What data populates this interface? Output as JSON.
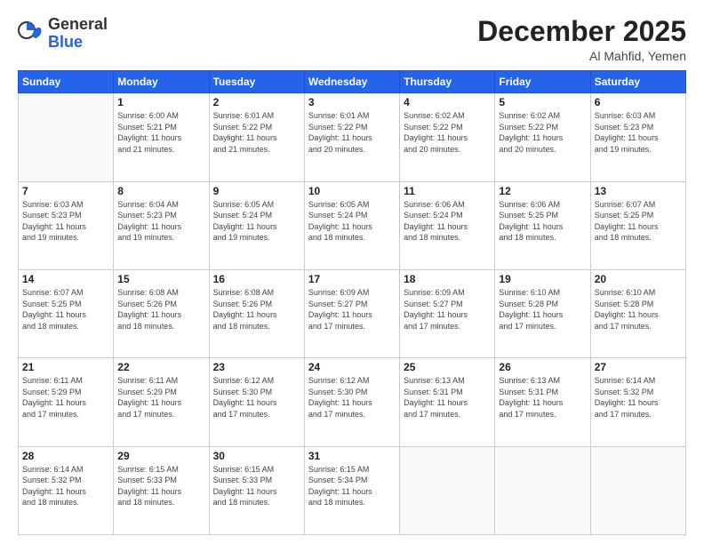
{
  "logo": {
    "general": "General",
    "blue": "Blue"
  },
  "header": {
    "month": "December 2025",
    "location": "Al Mahfid, Yemen"
  },
  "weekdays": [
    "Sunday",
    "Monday",
    "Tuesday",
    "Wednesday",
    "Thursday",
    "Friday",
    "Saturday"
  ],
  "weeks": [
    [
      {
        "day": "",
        "info": ""
      },
      {
        "day": "1",
        "info": "Sunrise: 6:00 AM\nSunset: 5:21 PM\nDaylight: 11 hours\nand 21 minutes."
      },
      {
        "day": "2",
        "info": "Sunrise: 6:01 AM\nSunset: 5:22 PM\nDaylight: 11 hours\nand 21 minutes."
      },
      {
        "day": "3",
        "info": "Sunrise: 6:01 AM\nSunset: 5:22 PM\nDaylight: 11 hours\nand 20 minutes."
      },
      {
        "day": "4",
        "info": "Sunrise: 6:02 AM\nSunset: 5:22 PM\nDaylight: 11 hours\nand 20 minutes."
      },
      {
        "day": "5",
        "info": "Sunrise: 6:02 AM\nSunset: 5:22 PM\nDaylight: 11 hours\nand 20 minutes."
      },
      {
        "day": "6",
        "info": "Sunrise: 6:03 AM\nSunset: 5:23 PM\nDaylight: 11 hours\nand 19 minutes."
      }
    ],
    [
      {
        "day": "7",
        "info": "Sunrise: 6:03 AM\nSunset: 5:23 PM\nDaylight: 11 hours\nand 19 minutes."
      },
      {
        "day": "8",
        "info": "Sunrise: 6:04 AM\nSunset: 5:23 PM\nDaylight: 11 hours\nand 19 minutes."
      },
      {
        "day": "9",
        "info": "Sunrise: 6:05 AM\nSunset: 5:24 PM\nDaylight: 11 hours\nand 19 minutes."
      },
      {
        "day": "10",
        "info": "Sunrise: 6:05 AM\nSunset: 5:24 PM\nDaylight: 11 hours\nand 18 minutes."
      },
      {
        "day": "11",
        "info": "Sunrise: 6:06 AM\nSunset: 5:24 PM\nDaylight: 11 hours\nand 18 minutes."
      },
      {
        "day": "12",
        "info": "Sunrise: 6:06 AM\nSunset: 5:25 PM\nDaylight: 11 hours\nand 18 minutes."
      },
      {
        "day": "13",
        "info": "Sunrise: 6:07 AM\nSunset: 5:25 PM\nDaylight: 11 hours\nand 18 minutes."
      }
    ],
    [
      {
        "day": "14",
        "info": "Sunrise: 6:07 AM\nSunset: 5:25 PM\nDaylight: 11 hours\nand 18 minutes."
      },
      {
        "day": "15",
        "info": "Sunrise: 6:08 AM\nSunset: 5:26 PM\nDaylight: 11 hours\nand 18 minutes."
      },
      {
        "day": "16",
        "info": "Sunrise: 6:08 AM\nSunset: 5:26 PM\nDaylight: 11 hours\nand 18 minutes."
      },
      {
        "day": "17",
        "info": "Sunrise: 6:09 AM\nSunset: 5:27 PM\nDaylight: 11 hours\nand 17 minutes."
      },
      {
        "day": "18",
        "info": "Sunrise: 6:09 AM\nSunset: 5:27 PM\nDaylight: 11 hours\nand 17 minutes."
      },
      {
        "day": "19",
        "info": "Sunrise: 6:10 AM\nSunset: 5:28 PM\nDaylight: 11 hours\nand 17 minutes."
      },
      {
        "day": "20",
        "info": "Sunrise: 6:10 AM\nSunset: 5:28 PM\nDaylight: 11 hours\nand 17 minutes."
      }
    ],
    [
      {
        "day": "21",
        "info": "Sunrise: 6:11 AM\nSunset: 5:29 PM\nDaylight: 11 hours\nand 17 minutes."
      },
      {
        "day": "22",
        "info": "Sunrise: 6:11 AM\nSunset: 5:29 PM\nDaylight: 11 hours\nand 17 minutes."
      },
      {
        "day": "23",
        "info": "Sunrise: 6:12 AM\nSunset: 5:30 PM\nDaylight: 11 hours\nand 17 minutes."
      },
      {
        "day": "24",
        "info": "Sunrise: 6:12 AM\nSunset: 5:30 PM\nDaylight: 11 hours\nand 17 minutes."
      },
      {
        "day": "25",
        "info": "Sunrise: 6:13 AM\nSunset: 5:31 PM\nDaylight: 11 hours\nand 17 minutes."
      },
      {
        "day": "26",
        "info": "Sunrise: 6:13 AM\nSunset: 5:31 PM\nDaylight: 11 hours\nand 17 minutes."
      },
      {
        "day": "27",
        "info": "Sunrise: 6:14 AM\nSunset: 5:32 PM\nDaylight: 11 hours\nand 17 minutes."
      }
    ],
    [
      {
        "day": "28",
        "info": "Sunrise: 6:14 AM\nSunset: 5:32 PM\nDaylight: 11 hours\nand 18 minutes."
      },
      {
        "day": "29",
        "info": "Sunrise: 6:15 AM\nSunset: 5:33 PM\nDaylight: 11 hours\nand 18 minutes."
      },
      {
        "day": "30",
        "info": "Sunrise: 6:15 AM\nSunset: 5:33 PM\nDaylight: 11 hours\nand 18 minutes."
      },
      {
        "day": "31",
        "info": "Sunrise: 6:15 AM\nSunset: 5:34 PM\nDaylight: 11 hours\nand 18 minutes."
      },
      {
        "day": "",
        "info": ""
      },
      {
        "day": "",
        "info": ""
      },
      {
        "day": "",
        "info": ""
      }
    ]
  ]
}
